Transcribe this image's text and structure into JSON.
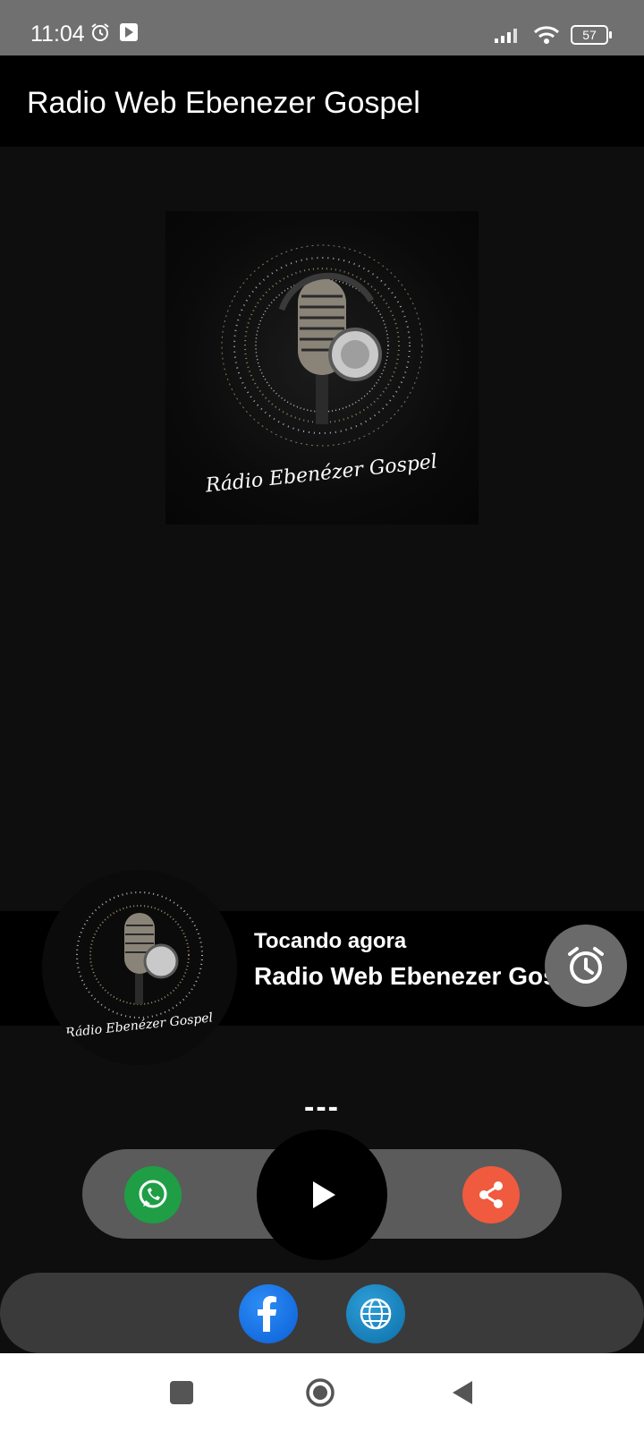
{
  "status_bar": {
    "time": "11:04",
    "battery": "57",
    "icons": [
      "alarm-icon",
      "play-store-icon",
      "signal-icon",
      "wifi-icon",
      "battery-icon"
    ]
  },
  "app_bar": {
    "title": "Radio Web Ebenezer Gospel"
  },
  "cover": {
    "logo_text": "Rádio Ebenézer Gospel"
  },
  "now_playing": {
    "label": "Tocando agora",
    "title": "Radio Web Ebenezer Gospel"
  },
  "track_info": "---",
  "controls": {
    "buttons": [
      "whatsapp-icon",
      "play-icon",
      "share-icon"
    ],
    "colors": {
      "whatsapp": "#1f9e45",
      "share": "#f05a3f",
      "bar": "#5b5b5b"
    }
  },
  "social": {
    "buttons": [
      "facebook-icon",
      "globe-icon"
    ]
  },
  "nav": {
    "buttons": [
      "recents-icon",
      "home-icon",
      "back-icon"
    ]
  }
}
